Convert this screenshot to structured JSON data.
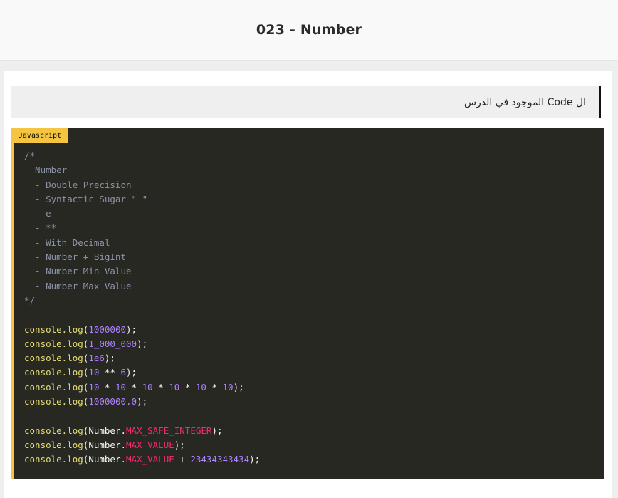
{
  "page": {
    "title": "023 - Number"
  },
  "section": {
    "heading": "ال Code الموجود في الدرس"
  },
  "code_block": {
    "language": "Javascript",
    "comment_lines": [
      "/*",
      "  Number",
      "  - Double Precision",
      "  - Syntactic Sugar \"_\"",
      "  - e",
      "  - **",
      "  - With Decimal",
      "  - Number + BigInt",
      "  - Number Min Value",
      "  - Number Max Value",
      "*/"
    ],
    "code_lines": [
      "",
      "console.log(1000000);",
      "console.log(1_000_000);",
      "console.log(1e6);",
      "console.log(10 ** 6);",
      "console.log(10 * 10 * 10 * 10 * 10 * 10);",
      "console.log(1000000.0);",
      "",
      "console.log(Number.MAX_SAFE_INTEGER);",
      "console.log(Number.MAX_VALUE);",
      "console.log(Number.MAX_VALUE + 23434343434);"
    ]
  },
  "colors": {
    "badge": "#f5c542",
    "code_bg": "#272822",
    "comment": "#8b93a8",
    "function": "#e6db74",
    "number": "#ae81ff",
    "property": "#f92672"
  }
}
